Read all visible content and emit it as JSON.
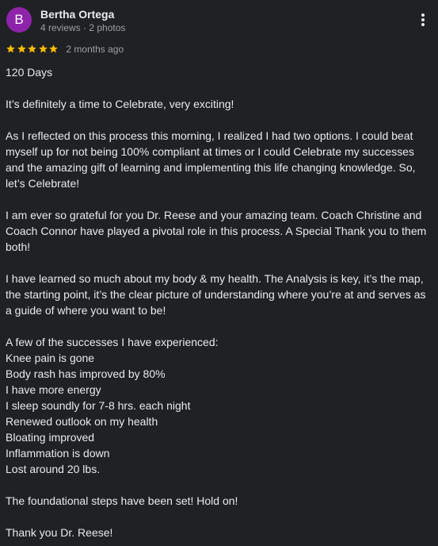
{
  "review": {
    "author": "Bertha Ortega",
    "avatar_letter": "B",
    "meta": "4 reviews · 2 photos",
    "rating": 5,
    "rating_max": 5,
    "time_ago": "2 months ago",
    "colors": {
      "avatar_bg": "#8e24aa",
      "star": "#fbbc04",
      "background": "#202124"
    },
    "icons": {
      "more": "more-vert-icon",
      "star": "star-icon"
    },
    "paragraphs": [
      "120 Days",
      "It’s definitely a time to Celebrate, very exciting!",
      "As I reflected on this process this morning, I realized I had two options. I could beat myself up for not being 100% compliant at times or I could Celebrate my successes and the amazing gift of learning and implementing this life changing knowledge. So, let’s Celebrate!",
      "I am ever so grateful for you Dr. Reese and your amazing team. Coach Christine and Coach Connor have played a pivotal role in this process. A Special Thank you to them both!",
      "I have learned so much about my body & my health. The Analysis is key, it’s the map, the starting point, it’s the clear picture of understanding where you’re at and serves as a guide of where you want to be!"
    ],
    "successes_intro": "A few of the successes I have experienced:",
    "successes": [
      "Knee pain is gone",
      "Body rash has improved by 80%",
      "I have more energy",
      "I sleep soundly for 7-8 hrs. each night",
      "Renewed outlook on my health",
      "Bloating improved",
      "Inflammation is down",
      "Lost around 20 lbs."
    ],
    "closing": [
      "The foundational steps have been set! Hold on!",
      "Thank you Dr. Reese!"
    ]
  }
}
